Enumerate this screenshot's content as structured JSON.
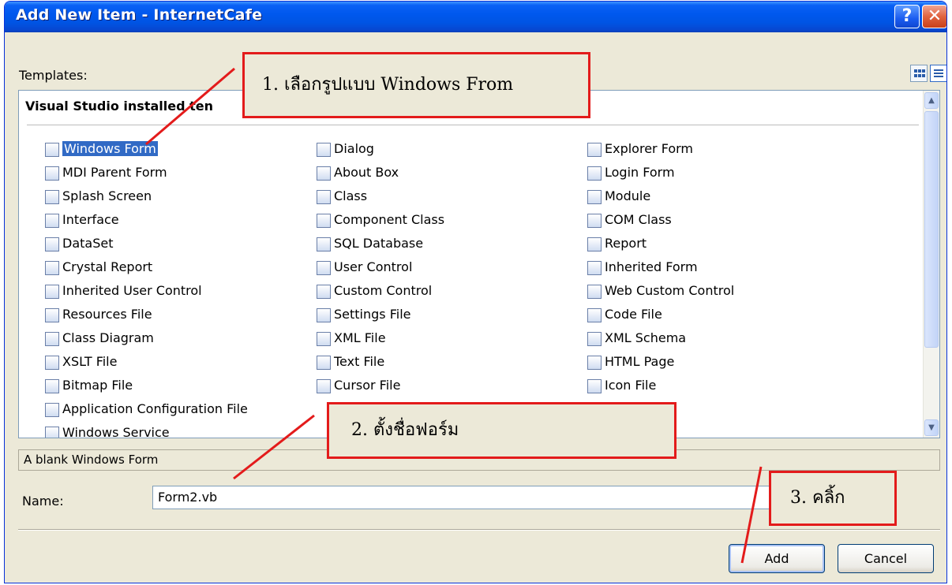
{
  "window": {
    "title": "Add New Item - InternetCafe",
    "help_glyph": "?",
    "close_glyph": "✕"
  },
  "templates_label": "Templates:",
  "group_header": "Visual Studio installed ten",
  "items_col1": [
    "Windows Form",
    "MDI Parent Form",
    "Splash Screen",
    "Interface",
    "DataSet",
    "Crystal Report",
    "Inherited User Control",
    "Resources File",
    "Class Diagram",
    "XSLT File",
    "Bitmap File",
    "Application Configuration File",
    "Windows Service"
  ],
  "items_col2": [
    "Dialog",
    "About Box",
    "Class",
    "Component Class",
    "SQL Database",
    "User Control",
    "Custom Control",
    "Settings File",
    "XML File",
    "Text File",
    "Cursor File"
  ],
  "items_col3": [
    "Explorer Form",
    "Login Form",
    "Module",
    "COM Class",
    "Report",
    "Inherited Form",
    "Web Custom Control",
    "Code File",
    "XML Schema",
    "HTML Page",
    "Icon File"
  ],
  "partial_item_text": "lass",
  "description": "A blank Windows Form",
  "name_label": "Name:",
  "name_value": "Form2.vb",
  "buttons": {
    "add": "Add",
    "cancel": "Cancel"
  },
  "annotations": {
    "step1": "1. เลือกรูปแบบ Windows From",
    "step2": "2. ตั้งชื่อฟอร์ม",
    "step3": "3. คลิ้ก"
  },
  "colors": {
    "title_bar": "#0054e3",
    "selection": "#316ac5",
    "callout_border": "#e31b1b",
    "dialog_face": "#ece9d8"
  }
}
